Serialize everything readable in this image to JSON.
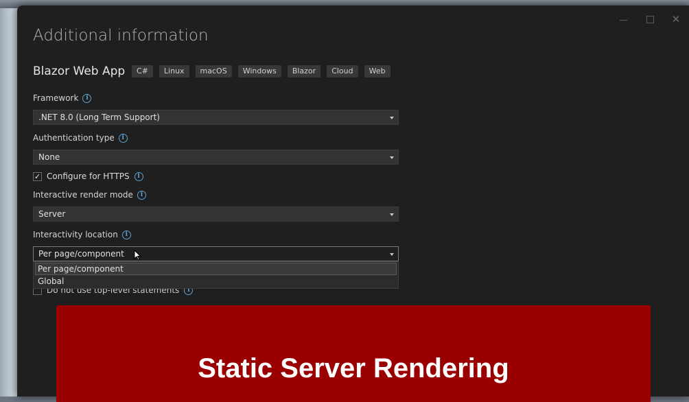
{
  "dialog": {
    "title": "Additional information",
    "template_name": "Blazor Web App",
    "tags": [
      "C#",
      "Linux",
      "macOS",
      "Windows",
      "Blazor",
      "Cloud",
      "Web"
    ]
  },
  "framework": {
    "label": "Framework",
    "value": ".NET 8.0 (Long Term Support)"
  },
  "authentication": {
    "label": "Authentication type",
    "value": "None"
  },
  "https": {
    "label": "Configure for HTTPS",
    "checked": true,
    "check_glyph": "✓"
  },
  "render_mode": {
    "label": "Interactive render mode",
    "value": "Server"
  },
  "interactivity_location": {
    "label": "Interactivity location",
    "value": "Per page/component",
    "options": [
      "Per page/component",
      "Global"
    ]
  },
  "top_level": {
    "label": "Do not use top-level statements",
    "checked": false
  },
  "banner": {
    "text": "Static Server Rendering",
    "color": "#9b0000"
  },
  "icons": {
    "info": "i",
    "close": "✕"
  },
  "colors": {
    "accent_info": "#5ea3d6",
    "window_bg": "#1f1f1f",
    "field_bg": "#333333"
  }
}
